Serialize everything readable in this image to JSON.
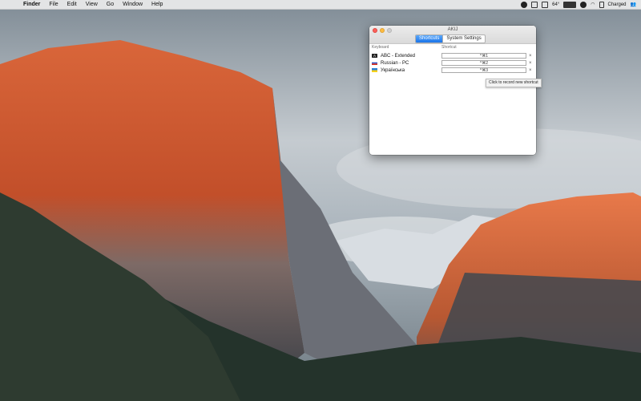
{
  "menubar": {
    "items": [
      "Finder",
      "File",
      "Edit",
      "View",
      "Go",
      "Window",
      "Help"
    ],
    "status": {
      "temperature": "64°",
      "battery_text": "Charged"
    }
  },
  "window": {
    "title": "AKIJ",
    "tabs": [
      {
        "label": "Shortcuts",
        "active": true
      },
      {
        "label": "System Settings",
        "active": false
      }
    ],
    "columns": {
      "keyboard": "Keyboard",
      "shortcut": "Shortcut"
    },
    "rows": [
      {
        "name": "ABC - Extended",
        "shortcut": "^⌘1",
        "icon": "abc-extended-icon"
      },
      {
        "name": "Russian - PC",
        "shortcut": "^⌘2",
        "icon": "russian-flag-icon"
      },
      {
        "name": "Українська",
        "shortcut": "^⌘3",
        "icon": "ukrainian-flag-icon"
      }
    ],
    "clear_glyph": "×"
  },
  "tooltip": "Click to record new shortcut",
  "colors": {
    "accent": "#1a73e8",
    "close": "#fc605b",
    "minimize": "#fdbc40"
  }
}
